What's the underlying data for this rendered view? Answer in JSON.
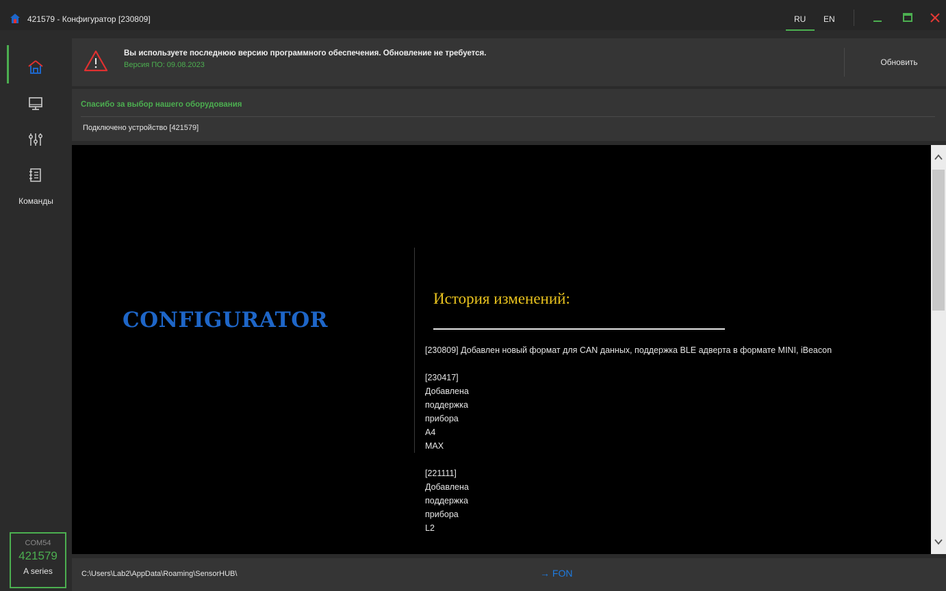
{
  "window": {
    "title": "421579 - Конфигуратор [230809]",
    "languages": [
      "RU",
      "EN"
    ],
    "active_language": "RU"
  },
  "sidebar": {
    "items": [
      {
        "icon": "home-icon",
        "active": true
      },
      {
        "icon": "monitor-icon",
        "active": false
      },
      {
        "icon": "sliders-icon",
        "active": false
      },
      {
        "icon": "notebook-icon",
        "active": false
      }
    ],
    "commands_label": "Команды",
    "device": {
      "port": "COM54",
      "id": "421579",
      "series": "A series"
    }
  },
  "update": {
    "message": "Вы используете последнюю версию программного обеспечения. Обновление не требуется.",
    "version": "Версия ПО: 09.08.2023",
    "button_label": "Обновить"
  },
  "info": {
    "thanks": "Спасибо за выбор нашего оборудования",
    "connected": "Подключено устройство [421579]"
  },
  "content": {
    "brand": "CONFIGURATOR",
    "history_title": "История изменений:",
    "entries": [
      {
        "text": "[230809] Добавлен новый формат для CAN данных, поддержка BLE адверта в формате MINI, iBeacon"
      },
      {
        "lines": [
          "[230417]",
          "Добавлена",
          "поддержка",
          "прибора",
          "A4",
          "MAX"
        ]
      },
      {
        "lines": [
          "[221111]",
          "Добавлена",
          "поддержка",
          "прибора",
          "L2"
        ]
      }
    ]
  },
  "statusbar": {
    "path": "C:\\Users\\Lab2\\AppData\\Roaming\\SensorHUB\\",
    "fon_label": "→ FON"
  },
  "colors": {
    "accent_green": "#4caf50",
    "brand_blue": "#1e66c8",
    "history_gold": "#e8c21e",
    "warning_red": "#e03030",
    "close_red": "#e53935"
  }
}
